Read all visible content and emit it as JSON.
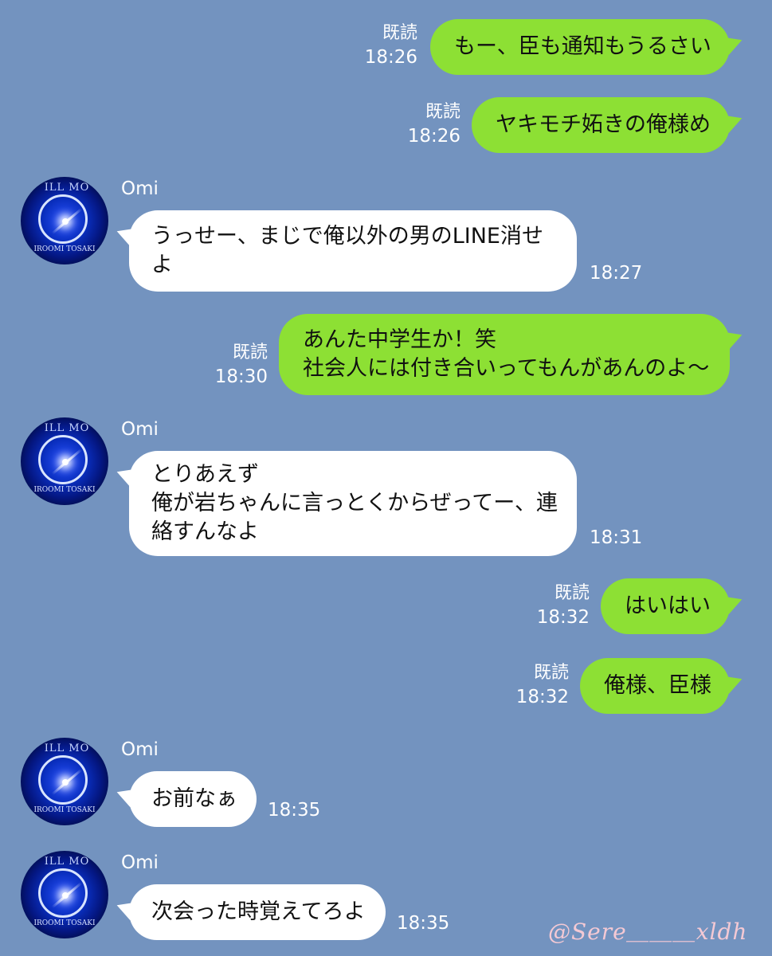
{
  "messages": [
    {
      "dir": "out",
      "text": "もー、臣も通知もうるさい",
      "read": "既読",
      "time": "18:26"
    },
    {
      "dir": "out",
      "text": "ヤキモチ妬きの俺様め",
      "read": "既読",
      "time": "18:26"
    },
    {
      "dir": "in",
      "sender": "Omi",
      "lines": [
        "うっせー、まじで俺以外の男のLINE消せ",
        "よ"
      ],
      "time": "18:27"
    },
    {
      "dir": "out",
      "lines": [
        "あんた中学生か！笑",
        "社会人には付き合いってもんがあんのよ〜"
      ],
      "read": "既読",
      "time": "18:30"
    },
    {
      "dir": "in",
      "sender": "Omi",
      "lines": [
        "とりあえず",
        "俺が岩ちゃんに言っとくからぜってー、連",
        "絡すんなよ"
      ],
      "time": "18:31"
    },
    {
      "dir": "out",
      "text": "はいはい",
      "read": "既読",
      "time": "18:32"
    },
    {
      "dir": "out",
      "text": "俺様、臣様",
      "read": "既読",
      "time": "18:32"
    },
    {
      "dir": "in",
      "sender": "Omi",
      "text": "お前なぁ",
      "time": "18:35"
    },
    {
      "dir": "in",
      "sender": "Omi",
      "text": "次会った時覚えてろよ",
      "time": "18:35"
    }
  ],
  "avatar": {
    "top_text": "ILL MO",
    "bottom_text": "IROOMI TOSAKI"
  },
  "watermark": "@Sere＿＿＿xldh",
  "colors": {
    "background": "#7393bf",
    "outgoing_bubble": "#8de034",
    "incoming_bubble": "#ffffff"
  }
}
